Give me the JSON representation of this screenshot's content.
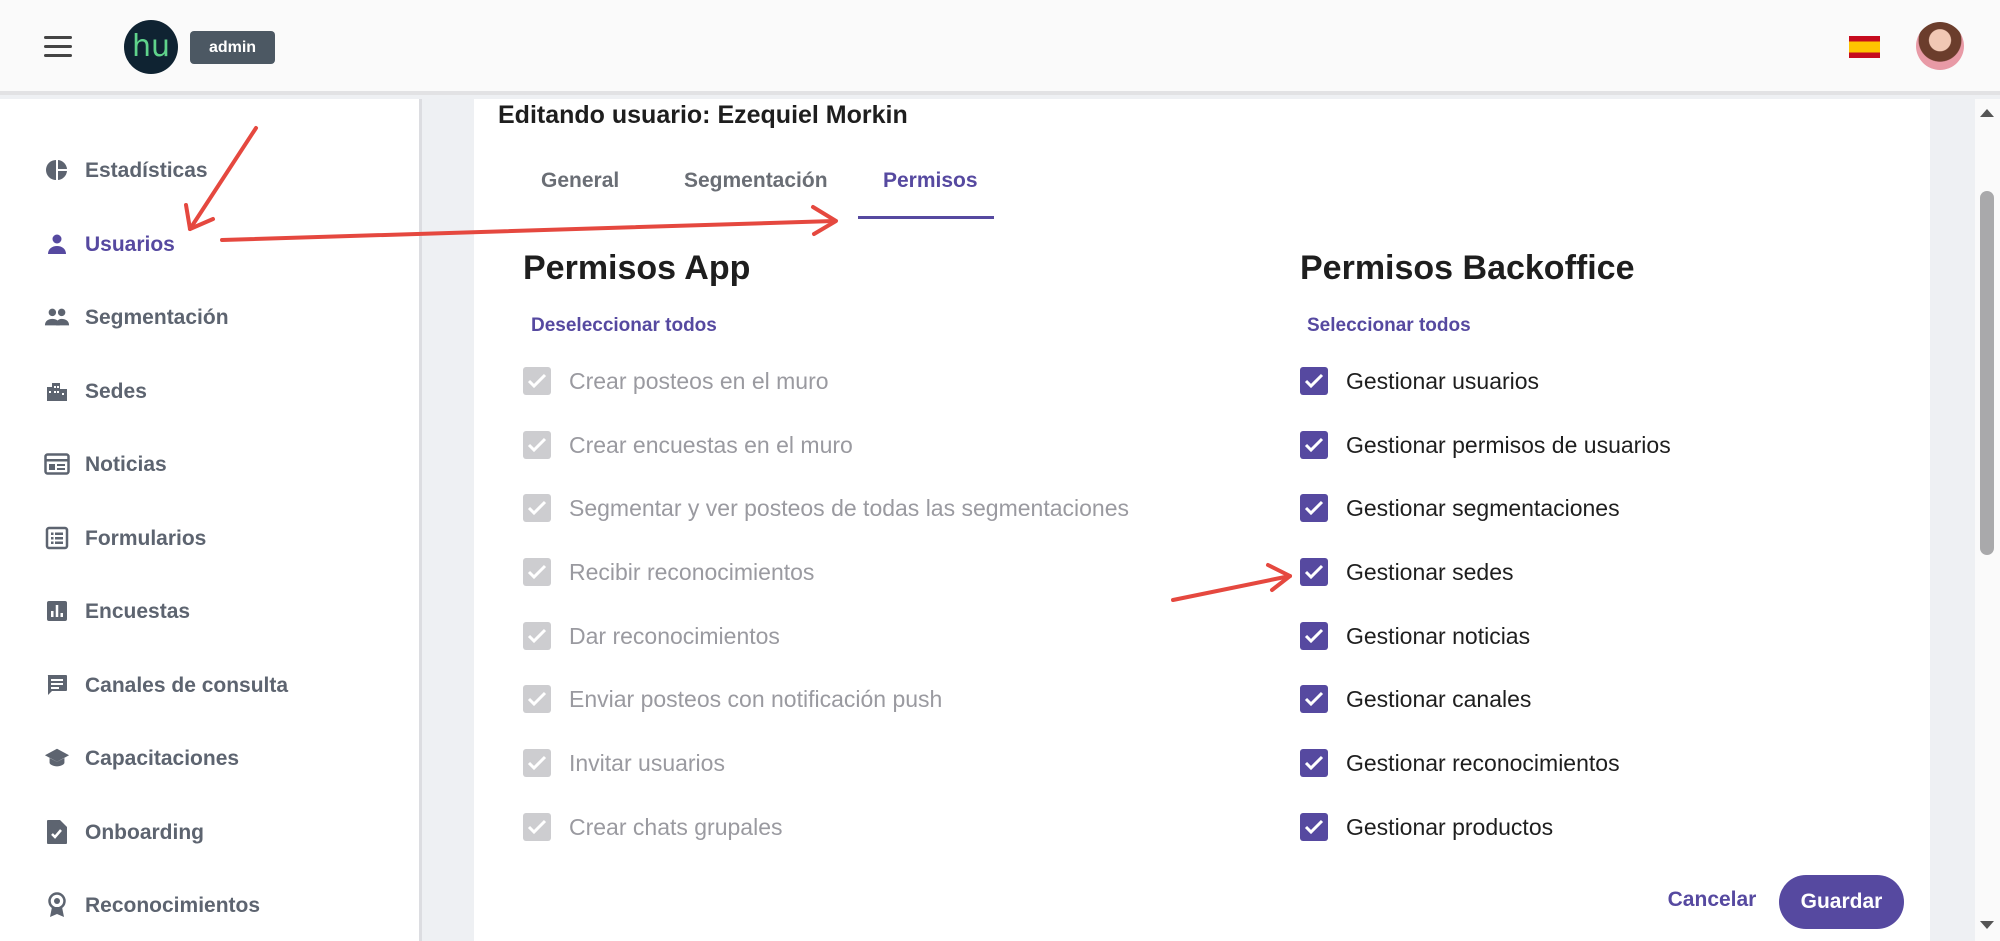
{
  "header": {
    "logo_text": "hu",
    "role_badge": "admin"
  },
  "sidebar": {
    "items": [
      {
        "label": "Estadísticas",
        "icon": "pie-chart-icon"
      },
      {
        "label": "Usuarios",
        "icon": "person-icon",
        "active": true
      },
      {
        "label": "Segmentación",
        "icon": "group-icon"
      },
      {
        "label": "Sedes",
        "icon": "building-icon"
      },
      {
        "label": "Noticias",
        "icon": "newspaper-icon"
      },
      {
        "label": "Formularios",
        "icon": "form-list-icon"
      },
      {
        "label": "Encuestas",
        "icon": "bar-chart-icon"
      },
      {
        "label": "Canales de consulta",
        "icon": "chat-icon"
      },
      {
        "label": "Capacitaciones",
        "icon": "graduation-cap-icon"
      },
      {
        "label": "Onboarding",
        "icon": "document-check-icon"
      },
      {
        "label": "Reconocimientos",
        "icon": "award-icon"
      }
    ]
  },
  "main": {
    "title": "Editando usuario: Ezequiel Morkin",
    "tabs": [
      {
        "label": "General"
      },
      {
        "label": "Segmentación"
      },
      {
        "label": "Permisos",
        "active": true
      }
    ],
    "app_permissions": {
      "title": "Permisos App",
      "toggle_link": "Deseleccionar todos",
      "items": [
        {
          "label": "Crear posteos en el muro",
          "checked": true
        },
        {
          "label": "Crear encuestas en el muro",
          "checked": true
        },
        {
          "label": "Segmentar y ver posteos de todas las segmentaciones",
          "checked": true
        },
        {
          "label": "Recibir reconocimientos",
          "checked": true
        },
        {
          "label": "Dar reconocimientos",
          "checked": true
        },
        {
          "label": "Enviar posteos con notificación push",
          "checked": true
        },
        {
          "label": "Invitar usuarios",
          "checked": true
        },
        {
          "label": "Crear chats grupales",
          "checked": true
        }
      ]
    },
    "backoffice_permissions": {
      "title": "Permisos Backoffice",
      "toggle_link": "Seleccionar todos",
      "items": [
        {
          "label": "Gestionar usuarios",
          "checked": true
        },
        {
          "label": "Gestionar permisos de usuarios",
          "checked": true
        },
        {
          "label": "Gestionar segmentaciones",
          "checked": true
        },
        {
          "label": "Gestionar sedes",
          "checked": true
        },
        {
          "label": "Gestionar noticias",
          "checked": true
        },
        {
          "label": "Gestionar canales",
          "checked": true
        },
        {
          "label": "Gestionar reconocimientos",
          "checked": true
        },
        {
          "label": "Gestionar productos",
          "checked": true
        }
      ]
    },
    "actions": {
      "cancel_label": "Cancelar",
      "save_label": "Guardar"
    }
  },
  "colors": {
    "accent": "#5649a0",
    "annotation_arrow": "#e5483f",
    "disabled_checkbox": "#cdcdd0"
  }
}
